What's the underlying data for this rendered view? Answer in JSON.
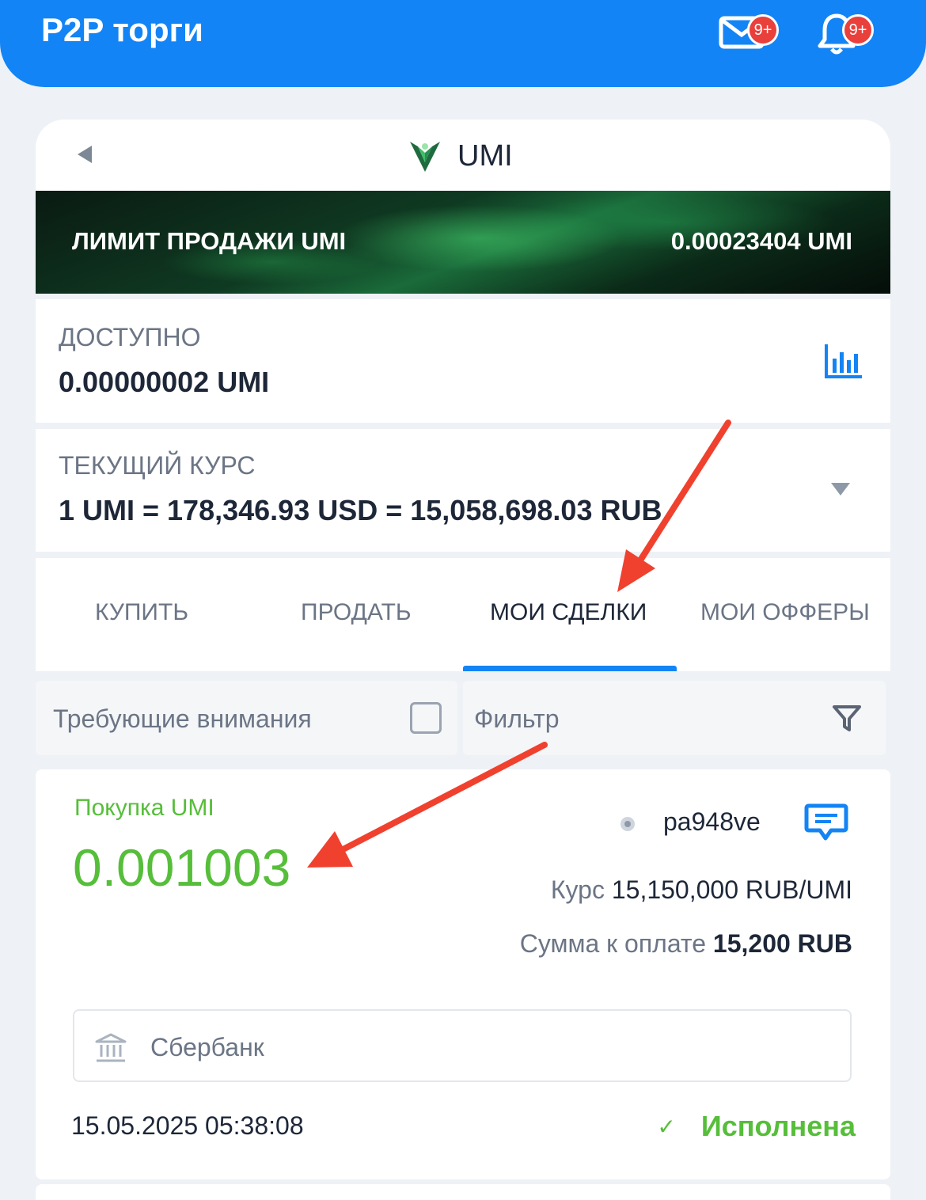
{
  "header": {
    "title": "P2P торги",
    "mail_badge": "9+",
    "bell_badge": "9+",
    "icons": [
      "mail-icon",
      "bell-icon"
    ]
  },
  "coin": {
    "name": "UMI",
    "icons": [
      "back-icon",
      "umi-logo-icon"
    ]
  },
  "banner": {
    "label": "ЛИМИТ ПРОДАЖИ UMI",
    "value": "0.00023404 UMI"
  },
  "available": {
    "label": "ДОСТУПНО",
    "value": "0.00000002 UMI",
    "icon": "bar-chart-icon"
  },
  "rate": {
    "label": "ТЕКУЩИЙ КУРС",
    "value": "1 UMI = 178,346.93 USD = 15,058,698.03 RUB",
    "icon": "dropdown-triangle-icon"
  },
  "tabs": [
    {
      "label": "КУПИТЬ",
      "active": false
    },
    {
      "label": "ПРОДАТЬ",
      "active": false
    },
    {
      "label": "МОИ СДЕЛКИ",
      "active": true
    },
    {
      "label": "МОИ ОФФЕРЫ",
      "active": false
    }
  ],
  "filters": {
    "attention_label": "Требующие внимания",
    "attention_checked": false,
    "filter_label": "Фильтр",
    "filter_icon": "funnel-icon"
  },
  "deal": {
    "type": "Покупка UMI",
    "amount": "0.001003",
    "username": "pa948ve",
    "rate_label": "Курс",
    "rate_value": "15,150,000 RUB/UMI",
    "sum_label": "Сумма к оплате",
    "sum_value": "15,200 RUB",
    "bank": "Сбербанк",
    "date": "15.05.2025 05:38:08",
    "status": "Исполнена",
    "icons": [
      "chat-icon",
      "bank-icon",
      "check-icon"
    ]
  },
  "colors": {
    "primary": "#1384f5",
    "success": "#56be3a",
    "badge": "#e9403c",
    "annotation_arrow": "#f0412e"
  }
}
